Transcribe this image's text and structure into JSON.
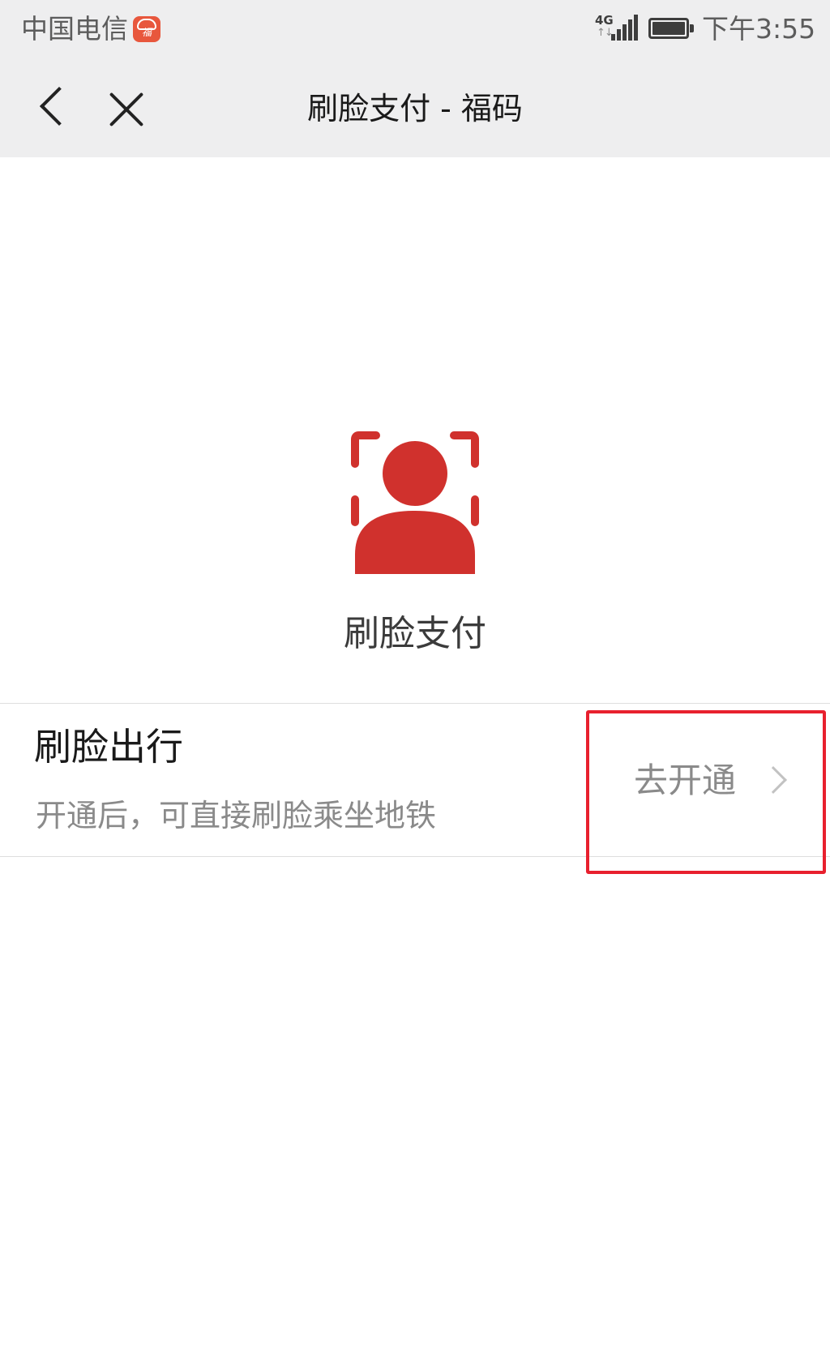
{
  "status_bar": {
    "carrier": "中国电信",
    "carrier_badge_icon": "fuxing-cloud-icon",
    "carrier_badge_text": "福",
    "network_type": "4G",
    "network_arrows": "↑↓",
    "signal_icon": "signal-bars-icon",
    "battery_icon": "battery-full-icon",
    "time": "下午3:55"
  },
  "nav": {
    "back_icon": "chevron-left-icon",
    "close_icon": "close-icon",
    "title": "刷脸支付 - 福码"
  },
  "hero": {
    "icon": "face-scan-user-icon",
    "icon_color": "#d0312d",
    "label": "刷脸支付"
  },
  "metro": {
    "title": "刷脸出行",
    "description": "开通后，可直接刷脸乘坐地铁",
    "action_label": "去开通",
    "action_icon": "chevron-right-icon"
  },
  "colors": {
    "nav_background": "#eeeeef",
    "accent": "#d0312d",
    "annotation": "#e8202e"
  }
}
